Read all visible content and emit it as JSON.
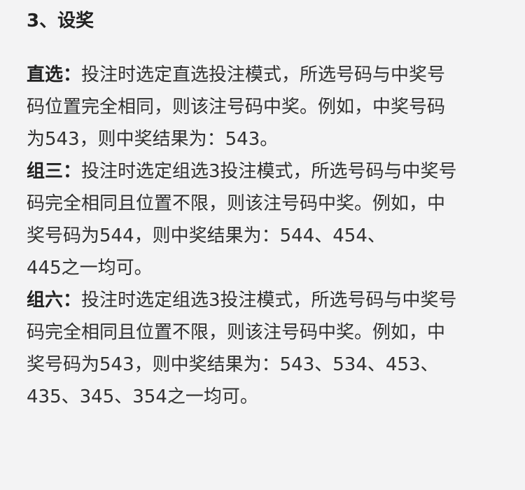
{
  "section": {
    "title": "3、设奖"
  },
  "rules": [
    {
      "label": "直选：",
      "lines": [
        "投注时选定直选投注模式，所选号码与中奖号",
        "码位置完全相同，则该注号码中奖。例如，中奖号码",
        "为543，则中奖结果为：543。"
      ]
    },
    {
      "label": "组三：",
      "lines": [
        "投注时选定组选3投注模式，所选号码与中奖号",
        "码完全相同且位置不限，则该注号码中奖。例如，中",
        "奖号码为544，则中奖结果为：544、454、",
        "445之一均可。"
      ]
    },
    {
      "label": "组六：",
      "lines": [
        "投注时选定组选3投注模式，所选号码与中奖号",
        "码完全相同且位置不限，则该注号码中奖。例如，中",
        "奖号码为543，则中奖结果为：543、534、453、",
        "435、345、354之一均可。"
      ]
    }
  ]
}
